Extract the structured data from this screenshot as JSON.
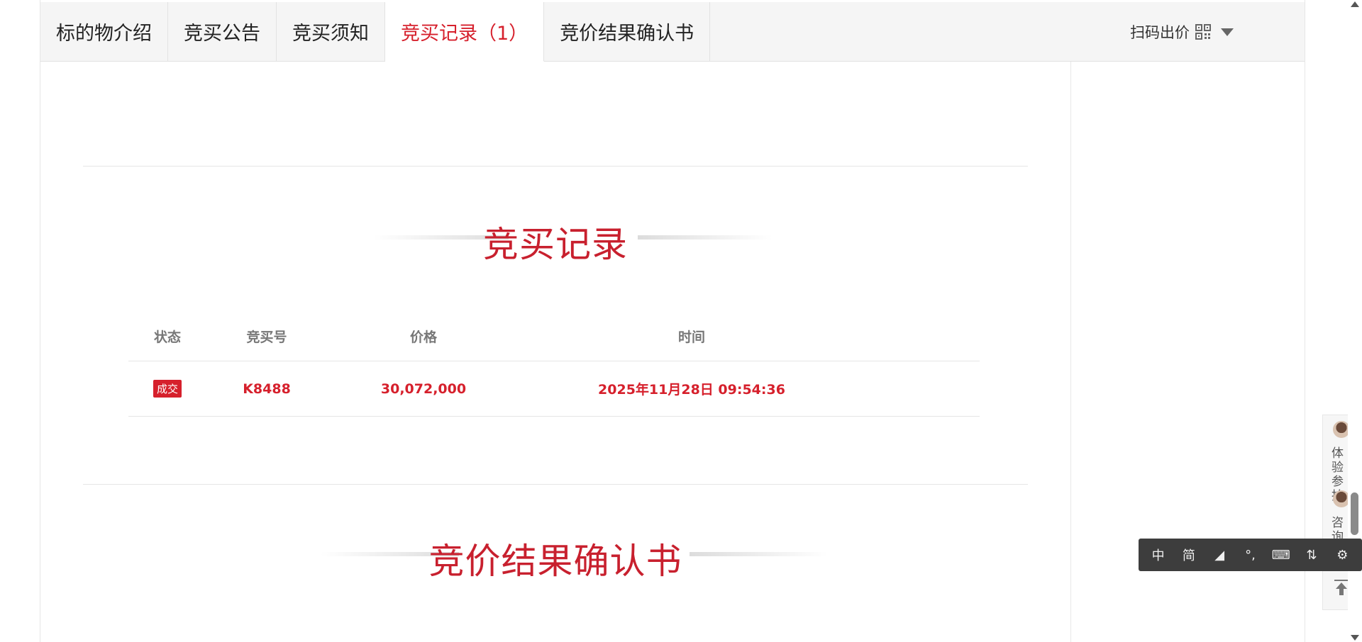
{
  "tabs": [
    {
      "label": "标的物介绍",
      "active": false
    },
    {
      "label": "竞买公告",
      "active": false
    },
    {
      "label": "竞买须知",
      "active": false
    },
    {
      "label": "竞买记录（1）",
      "active": true
    },
    {
      "label": "竞价结果确认书",
      "active": false
    }
  ],
  "scan_bid": {
    "label": "扫码出价",
    "icon": "qr-code-icon"
  },
  "sections": {
    "records_title": "竞买记录",
    "confirm_title": "竞价结果确认书"
  },
  "records_table": {
    "headers": [
      "状态",
      "竞买号",
      "价格",
      "时间"
    ],
    "rows": [
      {
        "status": "成交",
        "bid_no": "K8488",
        "price": "30,072,000",
        "time": "2025年11月28日 09:54:36"
      }
    ]
  },
  "float_panel": {
    "item1": "体验参拍",
    "item2": "咨询客服"
  },
  "ime_toolbar": {
    "items": [
      "中",
      "简",
      "◢",
      "°,",
      "⌨",
      "⇅",
      "⚙"
    ]
  },
  "colors": {
    "accent": "#d6202c",
    "title": "#c8202e",
    "tabbar_bg": "#f5f5f5"
  }
}
